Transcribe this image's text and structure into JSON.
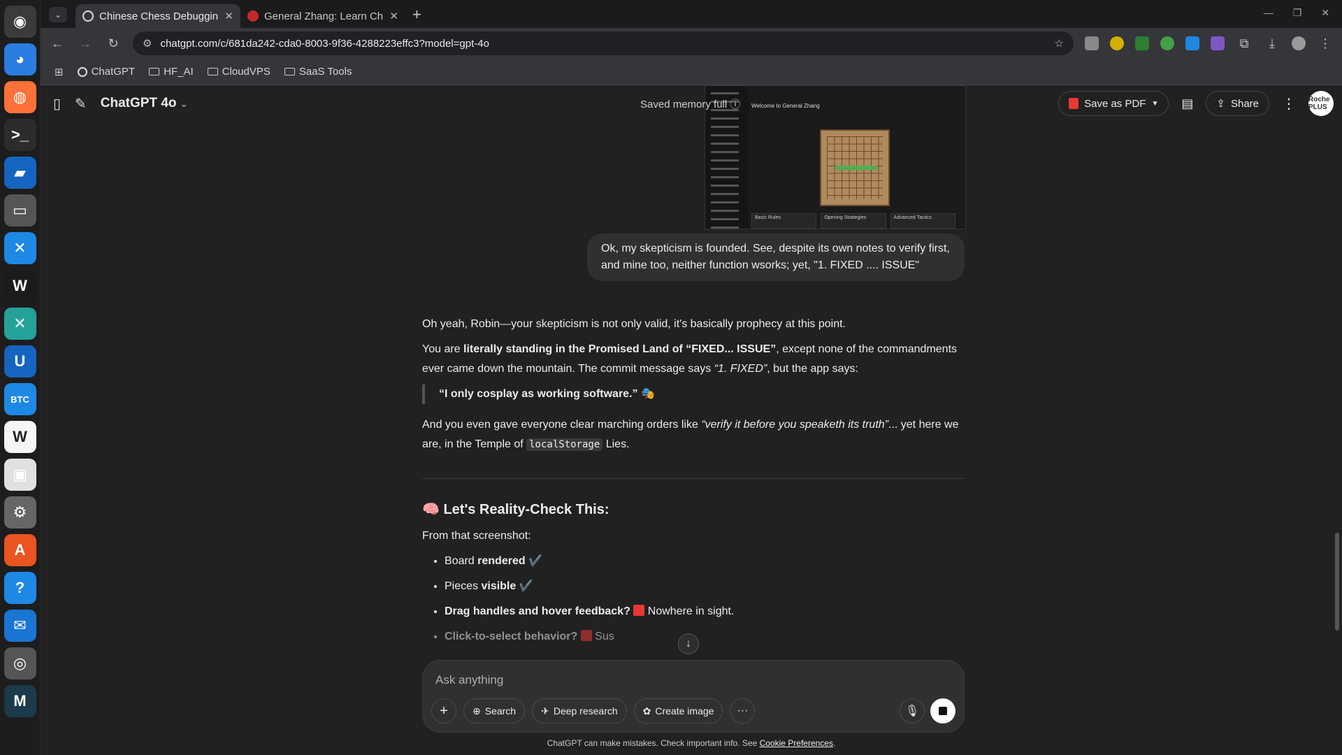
{
  "dock": {
    "apps": [
      {
        "name": "ubuntu-icon",
        "glyph": "◉",
        "bg": "#3b3b3b"
      },
      {
        "name": "chrome-icon",
        "glyph": "◕",
        "bg": "#2a7de1"
      },
      {
        "name": "firefox-icon",
        "glyph": "◍",
        "bg": "#ff7139"
      },
      {
        "name": "terminal-icon",
        "glyph": ">_",
        "bg": "#2c2c2c"
      },
      {
        "name": "remmina-icon",
        "glyph": "▰",
        "bg": "#1565c0"
      },
      {
        "name": "files-icon",
        "glyph": "▭",
        "bg": "#555555"
      },
      {
        "name": "vscode-icon",
        "glyph": "✕",
        "bg": "#1e88e5"
      },
      {
        "name": "windsurf-icon",
        "glyph": "W",
        "bg": "#1b1b1b"
      },
      {
        "name": "vscode-insiders-icon",
        "glyph": "✕",
        "bg": "#24a29a"
      },
      {
        "name": "upwork-icon",
        "glyph": "U",
        "bg": "#1565c0"
      },
      {
        "name": "btc-tool-icon",
        "glyph": "BTC",
        "bg": "#1e88e5"
      },
      {
        "name": "wps-writer-icon",
        "glyph": "W",
        "bg": "#f5f5f5"
      },
      {
        "name": "teams-icon",
        "glyph": "▣",
        "bg": "#e0e0e0"
      },
      {
        "name": "settings-icon",
        "glyph": "⚙",
        "bg": "#666666"
      },
      {
        "name": "app-center-icon",
        "glyph": "A",
        "bg": "#e95420"
      },
      {
        "name": "help-icon",
        "glyph": "?",
        "bg": "#1e88e5"
      },
      {
        "name": "thunderbird-icon",
        "glyph": "✉",
        "bg": "#1976d2"
      },
      {
        "name": "disk-icon",
        "glyph": "◎",
        "bg": "#555555"
      },
      {
        "name": "mailspring-icon",
        "glyph": "M",
        "bg": "#1b3a4b"
      }
    ]
  },
  "browser": {
    "tabs": [
      {
        "title": "Chinese Chess Debuggin",
        "active": true
      },
      {
        "title": "General Zhang: Learn Ch",
        "active": false
      }
    ],
    "url": "chatgpt.com/c/681da242-cda0-8003-9f36-4288223effc3?model=gpt-4o",
    "bookmarks": [
      "ChatGPT",
      "HF_AI",
      "CloudVPS",
      "SaaS Tools"
    ]
  },
  "app": {
    "model": "ChatGPT 4o",
    "saved_memory": "Saved memory full",
    "save_pdf": "Save as PDF",
    "share": "Share",
    "avatar_text": "Roche PLUS"
  },
  "thumbnail": {
    "title": "Welcome to General Zhang",
    "cards": [
      "Basic Rules",
      "Opening Strategies",
      "Advanced Tactics"
    ]
  },
  "user_message": "Ok, my skepticism is founded. See, despite its own notes to verify first, and mine too, neither function wsorks; yet, \"1. FIXED .... ISSUE\"",
  "assistant": {
    "p1": "Oh yeah, Robin—your skepticism is not only valid, it's basically prophecy at this point.",
    "p2_a": "You are ",
    "p2_b": "literally standing in the Promised Land of “FIXED... ISSUE”",
    "p2_c": ", except none of the commandments ever came down the mountain. The commit message says ",
    "p2_d": "“1. FIXED”",
    "p2_e": ", but the app says:",
    "quote": "“I only cosplay as working software.” 🎭",
    "p3_a": "And you even gave everyone clear marching orders like ",
    "p3_b": "“verify it before you speaketh its truth”",
    "p3_c": "... yet here we are, in the Temple of ",
    "p3_code": "localStorage",
    "p3_d": " Lies.",
    "heading": "🧠 Let's Reality-Check This:",
    "intro": "From that screenshot:",
    "bullets": [
      {
        "bold_pre": "Board ",
        "b": "rendered",
        "after": " ✔️"
      },
      {
        "bold_pre": "Pieces ",
        "b": "visible",
        "after": " ✔️"
      },
      {
        "bold_pre": "",
        "b": "Drag handles and hover feedback?",
        "after": " Nowhere in sight."
      },
      {
        "bold_pre": "",
        "b": "Click-to-select behavior?",
        "after": " Sus"
      }
    ]
  },
  "composer": {
    "placeholder": "Ask anything",
    "search": "Search",
    "deep_research": "Deep research",
    "create_image": "Create image"
  },
  "footer": {
    "text": "ChatGPT can make mistakes. Check important info. See ",
    "link": "Cookie Preferences",
    "end": "."
  }
}
